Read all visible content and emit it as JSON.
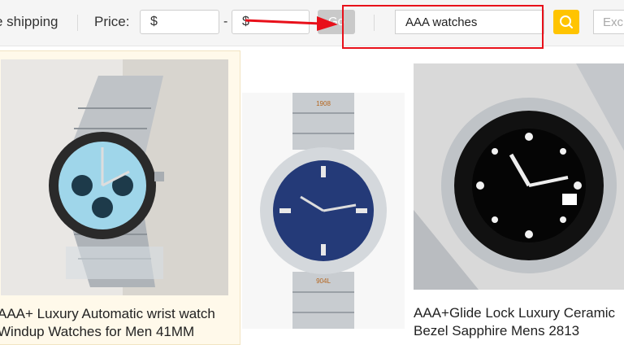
{
  "filters": {
    "free_shipping_label": "e shipping",
    "price_label": "Price:",
    "price_min_placeholder": "$",
    "price_separator": "-",
    "price_max_placeholder": "$",
    "go_label": "Go"
  },
  "search": {
    "value": "AAA watches",
    "exclude_placeholder": "Excl"
  },
  "colors": {
    "search_button": "#ffc400",
    "highlight": "#e8101a",
    "featured_card_bg": "#fff9ea"
  },
  "products": [
    {
      "title_line1": "AAA+ Luxury Automatic wrist watch",
      "title_line2": "Windup Watches for Men 41MM",
      "image_icon": "chronograph-watch-image"
    },
    {
      "dial_top_text": "1908",
      "dial_bottom_text": "904L",
      "image_icon": "blue-dial-watch-image"
    },
    {
      "title_line1": "AAA+Glide Lock Luxury Ceramic",
      "title_line2": "Bezel Sapphire Mens 2813",
      "image_icon": "diver-watch-image"
    }
  ]
}
